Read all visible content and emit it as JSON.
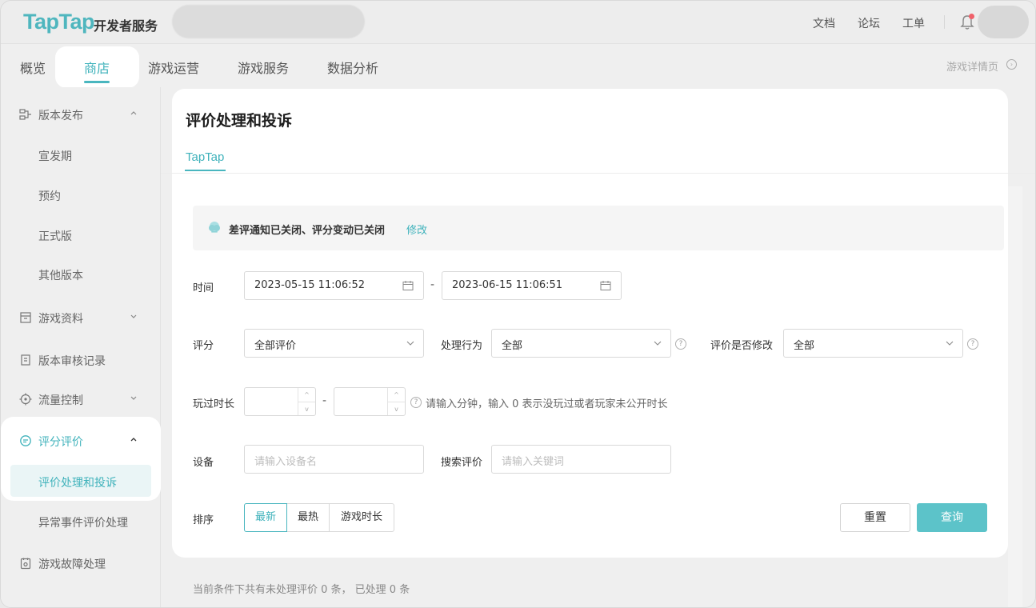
{
  "header": {
    "logo": "TapTap",
    "logo_sub": "开发者服务",
    "links": [
      "文档",
      "论坛",
      "工单"
    ]
  },
  "nav": {
    "tabs": [
      "概览",
      "商店",
      "游戏运营",
      "游戏服务",
      "数据分析"
    ],
    "active_tab": "商店",
    "detail_link": "游戏详情页"
  },
  "sidebar": {
    "release": "版本发布",
    "release_subs": [
      "宣发期",
      "预约",
      "正式版",
      "其他版本"
    ],
    "game_info": "游戏资料",
    "review_record": "版本审核记录",
    "traffic": "流量控制",
    "rating": "评分评价",
    "rating_subs": [
      "评价处理和投诉",
      "异常事件评价处理"
    ],
    "fault": "游戏故障处理"
  },
  "main": {
    "title": "评价处理和投诉",
    "sub_tab": "TapTap",
    "notice_text": "差评通知已关闭、评分变动已关闭",
    "notice_link": "修改",
    "time_label": "时间",
    "time_start": "2023-05-15 11:06:52",
    "time_end": "2023-06-15 11:06:51",
    "score_label": "评分",
    "score_value": "全部评价",
    "action_label": "处理行为",
    "action_value": "全部",
    "modified_label": "评价是否修改",
    "modified_value": "全部",
    "playtime_label": "玩过时长",
    "playtime_hint": "请输入分钟，输入 0 表示没玩过或者玩家未公开时长",
    "device_label": "设备",
    "device_placeholder": "请输入设备名",
    "search_label": "搜索评价",
    "search_placeholder": "请输入关键词",
    "sort_label": "排序",
    "sort_options": [
      "最新",
      "最热",
      "游戏时长"
    ],
    "sort_active": "最新",
    "reset_button": "重置",
    "query_button": "查询",
    "footer_note": "当前条件下共有未处理评价 0 条， 已处理 0 条"
  },
  "colors": {
    "accent": "#3fb2bb",
    "query_button": "#5cc3c9",
    "bell_dot": "#f0616a"
  }
}
